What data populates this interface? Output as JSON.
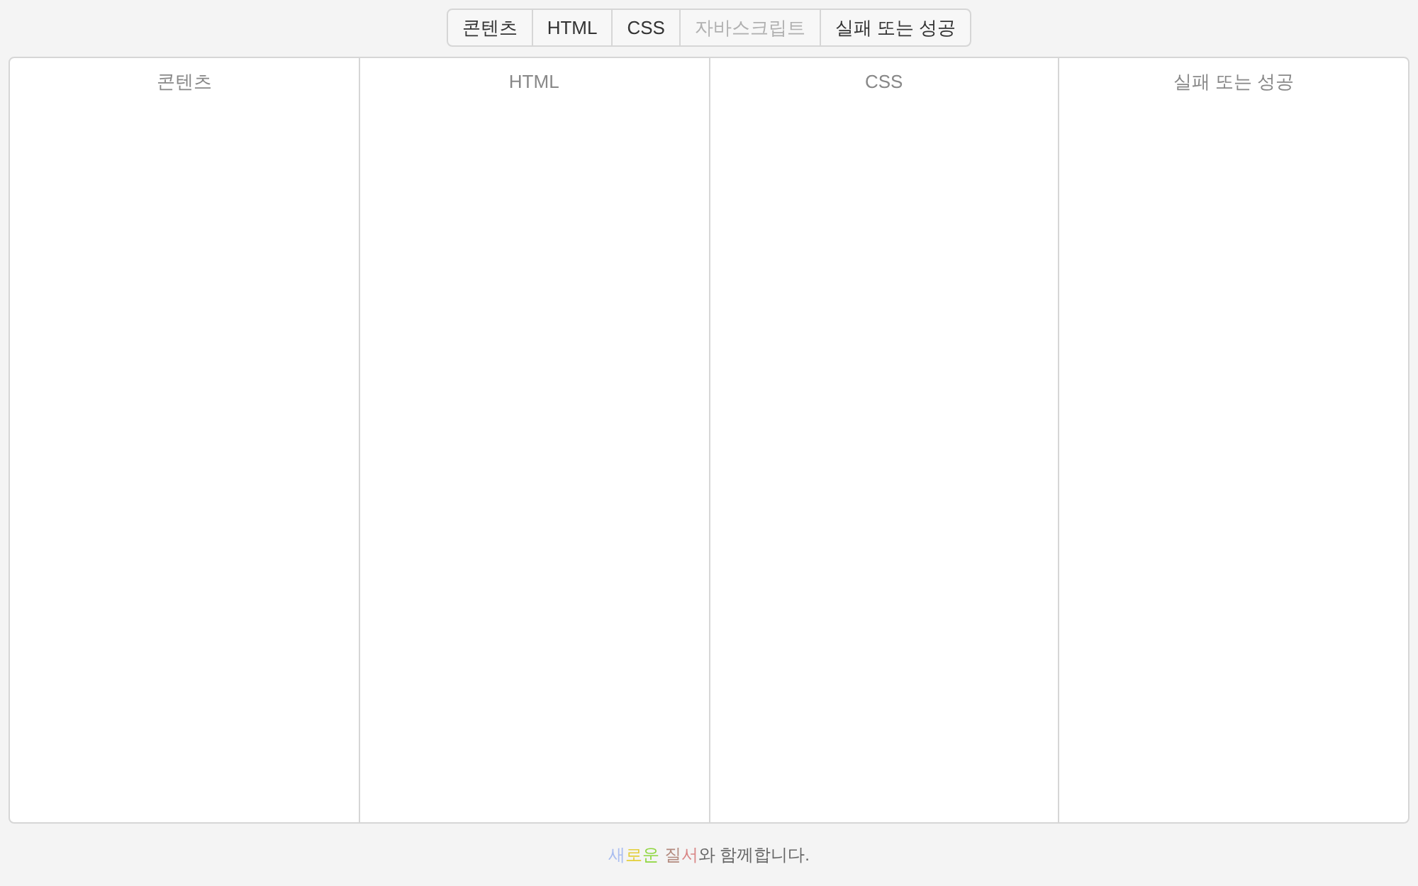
{
  "tabs": [
    {
      "label": "콘텐츠",
      "disabled": false
    },
    {
      "label": "HTML",
      "disabled": false
    },
    {
      "label": "CSS",
      "disabled": false
    },
    {
      "label": "자바스크립트",
      "disabled": true
    },
    {
      "label": "실패 또는 성공",
      "disabled": false
    }
  ],
  "panels": [
    {
      "title": "콘텐츠"
    },
    {
      "title": "HTML"
    },
    {
      "title": "CSS"
    },
    {
      "title": "실패 또는 성공"
    }
  ],
  "footer": [
    {
      "text": "새",
      "color": "#a9bdf0"
    },
    {
      "text": "로",
      "color": "#e3cf3c"
    },
    {
      "text": "운 ",
      "color": "#8fd640"
    },
    {
      "text": "질",
      "color": "#b38a7e"
    },
    {
      "text": "서",
      "color": "#d98585"
    },
    {
      "text": "와 함께합니다.",
      "color": "#666666"
    }
  ]
}
